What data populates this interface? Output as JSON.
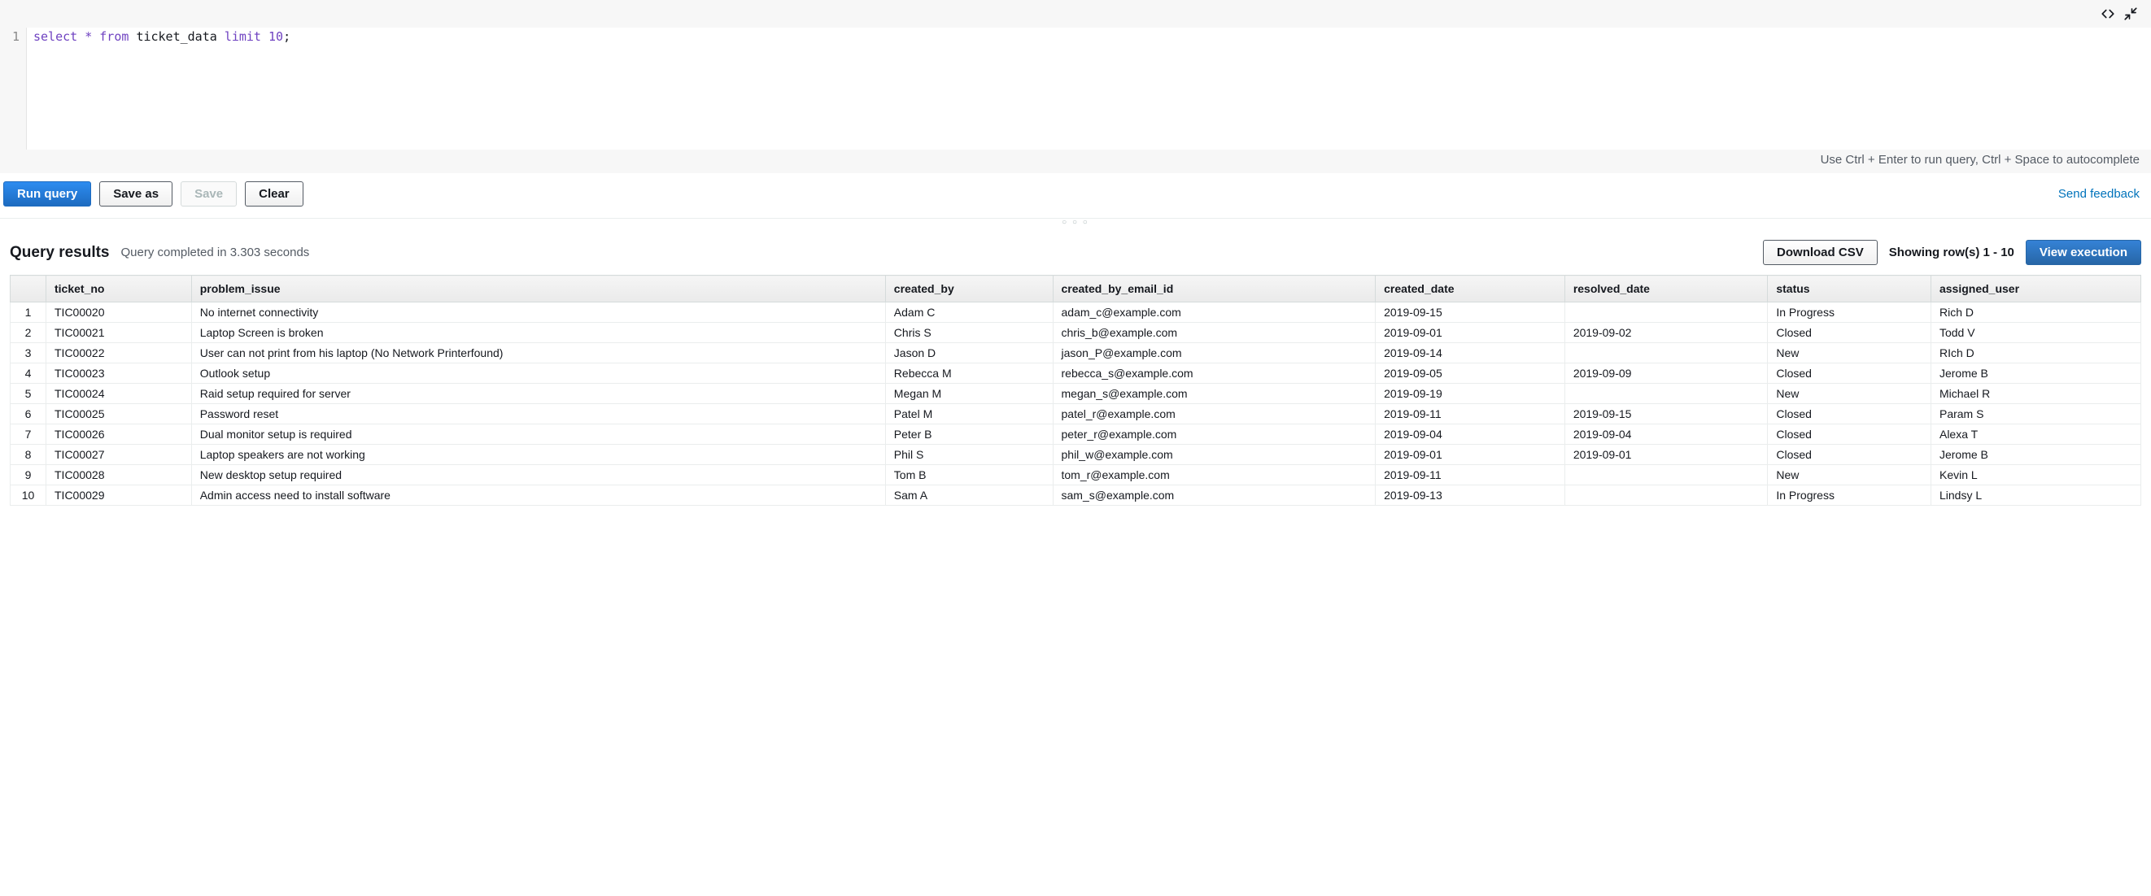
{
  "editor": {
    "line_number": "1",
    "tokens": {
      "select": "select",
      "star": "*",
      "from": "from",
      "table": "ticket_data",
      "limit": "limit",
      "n": "10",
      "semi": ";"
    },
    "hint": "Use Ctrl + Enter to run query, Ctrl + Space to autocomplete"
  },
  "toolbar": {
    "run": "Run query",
    "save_as": "Save as",
    "save": "Save",
    "clear": "Clear",
    "feedback": "Send feedback"
  },
  "results": {
    "title": "Query results",
    "status": "Query completed in 3.303 seconds",
    "download": "Download CSV",
    "rowinfo": "Showing row(s) 1 - 10",
    "view_exec": "View execution",
    "columns": [
      "ticket_no",
      "problem_issue",
      "created_by",
      "created_by_email_id",
      "created_date",
      "resolved_date",
      "status",
      "assigned_user"
    ],
    "rows": [
      {
        "n": "1",
        "ticket_no": "TIC00020",
        "problem_issue": "No internet connectivity",
        "created_by": "Adam C",
        "created_by_email_id": "adam_c@example.com",
        "created_date": "2019-09-15",
        "resolved_date": "",
        "status": "In Progress",
        "assigned_user": "Rich D"
      },
      {
        "n": "2",
        "ticket_no": "TIC00021",
        "problem_issue": "Laptop Screen is broken",
        "created_by": "Chris S",
        "created_by_email_id": "chris_b@example.com",
        "created_date": "2019-09-01",
        "resolved_date": "2019-09-02",
        "status": "Closed",
        "assigned_user": "Todd V"
      },
      {
        "n": "3",
        "ticket_no": "TIC00022",
        "problem_issue": "User can not print from his laptop (No Network Printerfound)",
        "created_by": "Jason D",
        "created_by_email_id": "jason_P@example.com",
        "created_date": "2019-09-14",
        "resolved_date": "",
        "status": "New",
        "assigned_user": "RIch D"
      },
      {
        "n": "4",
        "ticket_no": "TIC00023",
        "problem_issue": "Outlook setup",
        "created_by": "Rebecca M",
        "created_by_email_id": "rebecca_s@example.com",
        "created_date": "2019-09-05",
        "resolved_date": "2019-09-09",
        "status": "Closed",
        "assigned_user": "Jerome B"
      },
      {
        "n": "5",
        "ticket_no": "TIC00024",
        "problem_issue": "Raid setup required for server",
        "created_by": "Megan M",
        "created_by_email_id": "megan_s@example.com",
        "created_date": "2019-09-19",
        "resolved_date": "",
        "status": "New",
        "assigned_user": "Michael R"
      },
      {
        "n": "6",
        "ticket_no": "TIC00025",
        "problem_issue": "Password reset",
        "created_by": "Patel M",
        "created_by_email_id": "patel_r@example.com",
        "created_date": "2019-09-11",
        "resolved_date": "2019-09-15",
        "status": "Closed",
        "assigned_user": "Param S"
      },
      {
        "n": "7",
        "ticket_no": "TIC00026",
        "problem_issue": "Dual monitor setup is required",
        "created_by": "Peter B",
        "created_by_email_id": "peter_r@example.com",
        "created_date": "2019-09-04",
        "resolved_date": "2019-09-04",
        "status": "Closed",
        "assigned_user": "Alexa T"
      },
      {
        "n": "8",
        "ticket_no": "TIC00027",
        "problem_issue": "Laptop speakers are not working",
        "created_by": "Phil S",
        "created_by_email_id": "phil_w@example.com",
        "created_date": "2019-09-01",
        "resolved_date": "2019-09-01",
        "status": "Closed",
        "assigned_user": "Jerome B"
      },
      {
        "n": "9",
        "ticket_no": "TIC00028",
        "problem_issue": "New desktop setup required",
        "created_by": "Tom B",
        "created_by_email_id": "tom_r@example.com",
        "created_date": "2019-09-11",
        "resolved_date": "",
        "status": "New",
        "assigned_user": "Kevin L"
      },
      {
        "n": "10",
        "ticket_no": "TIC00029",
        "problem_issue": "Admin access need to install software",
        "created_by": "Sam A",
        "created_by_email_id": "sam_s@example.com",
        "created_date": "2019-09-13",
        "resolved_date": "",
        "status": "In Progress",
        "assigned_user": "Lindsy L"
      }
    ]
  }
}
